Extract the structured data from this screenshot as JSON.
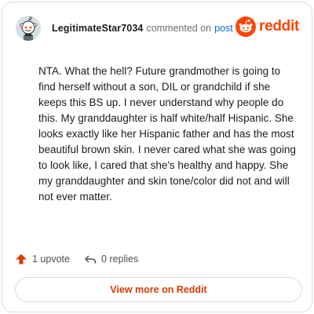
{
  "comment": {
    "username": "LegitimateStar7034",
    "action_text": "commented on",
    "post_link": "post",
    "body": "NTA. What the hell? Future grandmother is going to find herself without a son, DIL or grandchild if she keeps this BS up. I never understand why people do this. My granddaughter is half white/half Hispanic. She looks exactly like her Hispanic father and has the most beautiful brown skin. I never cared what she was going to look like, I cared that she's healthy and happy. She my granddaughter and skin tone/color did not and will not ever matter."
  },
  "brand": {
    "name": "reddit",
    "color": "#ff4500",
    "icon": "reddit-logo-icon"
  },
  "avatar": {
    "icon": "snoo-avatar-icon"
  },
  "actions": {
    "upvotes": "1 upvote",
    "upvote_icon": "upvote-arrow-icon",
    "replies": "0 replies",
    "reply_icon": "reply-arrow-icon"
  },
  "view_button": {
    "label": "View more on Reddit"
  }
}
